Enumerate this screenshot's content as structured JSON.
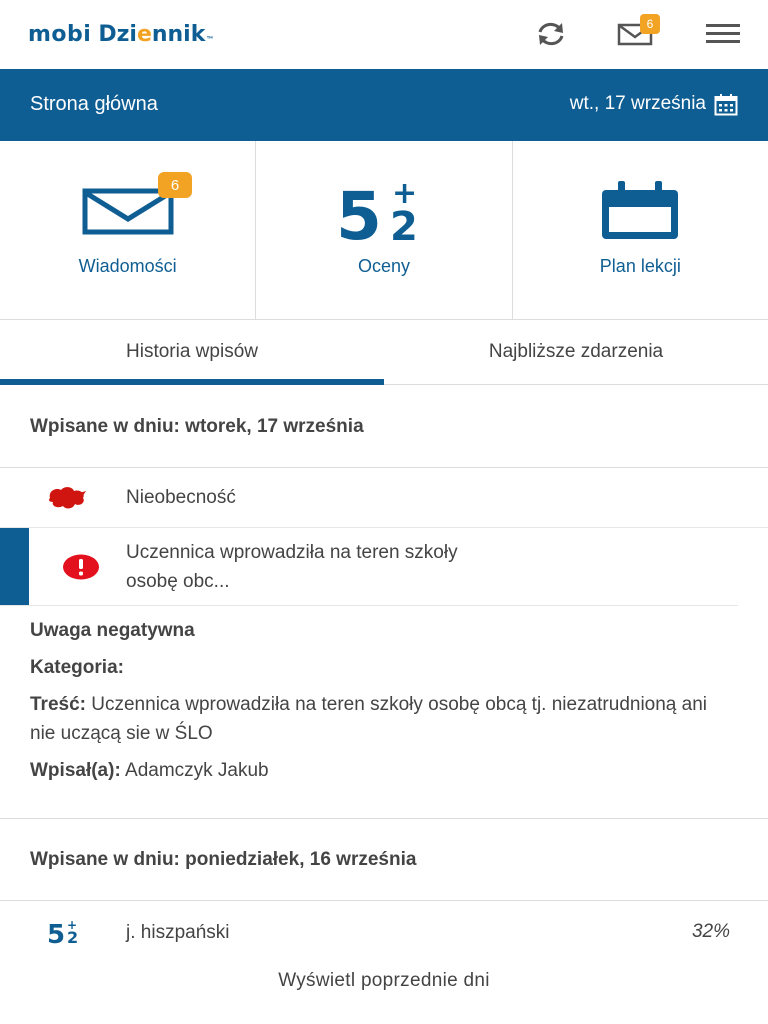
{
  "app": {
    "logo_part1": "mobi",
    "logo_part2a": "Dzi",
    "logo_part2b": "e",
    "logo_part2c": "nnik",
    "logo_tm": "™"
  },
  "topbar": {
    "mail_badge": "6"
  },
  "header": {
    "title": "Strona główna",
    "date": "wt., 17 września"
  },
  "tiles": [
    {
      "label": "Wiadomości",
      "badge": "6",
      "icon": "envelope-icon"
    },
    {
      "label": "Oceny",
      "icon": "grades-icon"
    },
    {
      "label": "Plan lekcji",
      "icon": "calendar-icon"
    }
  ],
  "tabs": [
    {
      "label": "Historia wpisów",
      "active": true
    },
    {
      "label": "Najbliższe zdarzenia",
      "active": false
    }
  ],
  "days": [
    {
      "header": "Wpisane w dniu: wtorek, 17 września",
      "entries": [
        {
          "icon": "absence-icon",
          "text": "Nieobecność"
        },
        {
          "icon": "warning-icon",
          "text_line1": "Uczennica wprowadziła na teren szkoły",
          "text_line2": "osobę obc..."
        }
      ],
      "detail": {
        "type": "Uwaga negatywna",
        "category_label": "Kategoria:",
        "content_label": "Treść:",
        "content": "Uczennica wprowadziła na teren szkoły osobę obcą tj. niezatrudnioną ani nie uczącą sie w ŚLO",
        "author_label": "Wpisał(a):",
        "author": "Adamczyk Jakub"
      }
    },
    {
      "header": "Wpisane w dniu: poniedziałek, 16 września",
      "entries": [
        {
          "icon": "grade-icon",
          "text": "j. hiszpański",
          "value": "32%"
        }
      ]
    }
  ],
  "more_label": "Wyświetl poprzednie dni",
  "colors": {
    "primary": "#0f5e93",
    "badge": "#f2a323",
    "alert": "#e3101e"
  }
}
